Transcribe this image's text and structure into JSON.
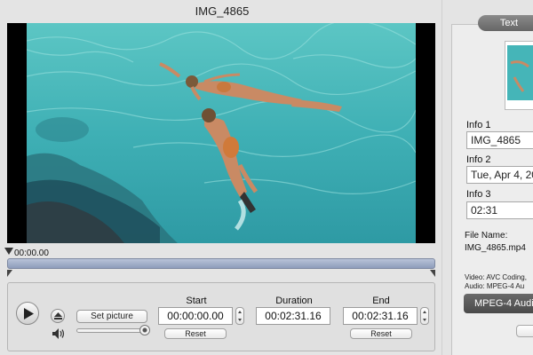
{
  "window": {
    "title": "IMG_4865"
  },
  "timeline": {
    "current_time": "00:00.00"
  },
  "controls": {
    "set_picture_label": "Set picture",
    "volume_level": 1.0,
    "start": {
      "label": "Start",
      "value": "00:00:00.00",
      "reset_label": "Reset"
    },
    "duration": {
      "label": "Duration",
      "value": "00:02:31.16"
    },
    "end": {
      "label": "End",
      "value": "00:02:31.16",
      "reset_label": "Reset"
    }
  },
  "sidebar": {
    "tab_label": "Text",
    "info1": {
      "label": "Info 1",
      "value": "IMG_4865"
    },
    "info2": {
      "label": "Info 2",
      "value": "Tue, Apr 4, 20"
    },
    "info3": {
      "label": "Info 3",
      "value": "02:31"
    },
    "file_name_label": "File Name:",
    "file_name": "IMG_4865.mp4",
    "video_info": "Video: AVC Coding,",
    "audio_info": "Audio: MPEG-4 Au",
    "codec_button_label": "MPEG-4 Audi"
  },
  "icons": {
    "play": "play-icon",
    "eject": "eject-icon",
    "volume": "speaker-icon"
  },
  "colors": {
    "water": "#3fb4b7",
    "timeline": "#9aa6c2",
    "codec_button": "#555555"
  }
}
